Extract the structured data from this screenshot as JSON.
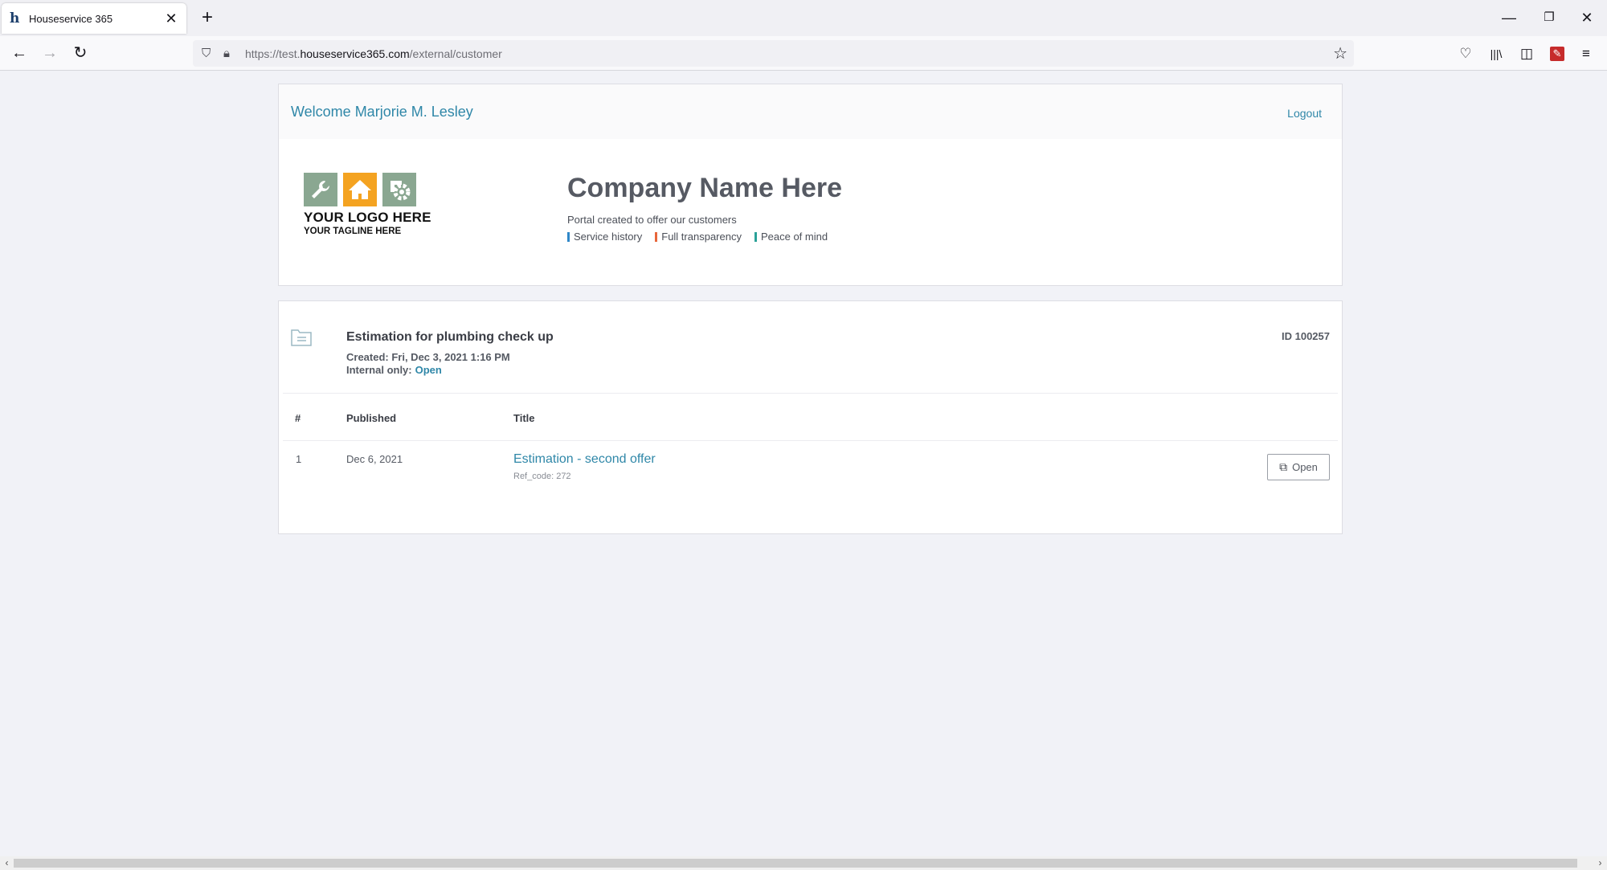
{
  "browser": {
    "tab_title": "Houseservice 365",
    "url_prefix": "https://test.",
    "url_host": "houseservice365.com",
    "url_path": "/external/customer"
  },
  "header": {
    "welcome": "Welcome Marjorie M. Lesley",
    "logout": "Logout"
  },
  "logo": {
    "main": "YOUR LOGO HERE",
    "tagline": "YOUR TAGLINE HERE"
  },
  "company": {
    "name": "Company Name Here",
    "subtitle": "Portal created to offer our customers",
    "pillars": [
      {
        "label": "Service history",
        "color": "#2f87c8"
      },
      {
        "label": "Full transparency",
        "color": "#e8663a"
      },
      {
        "label": "Peace of mind",
        "color": "#2aa198"
      }
    ]
  },
  "estimate": {
    "title": "Estimation for plumbing check up",
    "created": "Created: Fri, Dec 3, 2021 1:16 PM",
    "internal_label": "Internal only:",
    "internal_value": "Open",
    "id": "ID 100257",
    "columns": [
      "#",
      "Published",
      "Title"
    ],
    "rows": [
      {
        "num": "1",
        "published": "Dec 6, 2021",
        "title": "Estimation - second offer",
        "ref": "Ref_code: 272",
        "action": "Open"
      }
    ]
  },
  "colors": {
    "accent": "#2f87a8",
    "background": "#f1f2f7"
  }
}
